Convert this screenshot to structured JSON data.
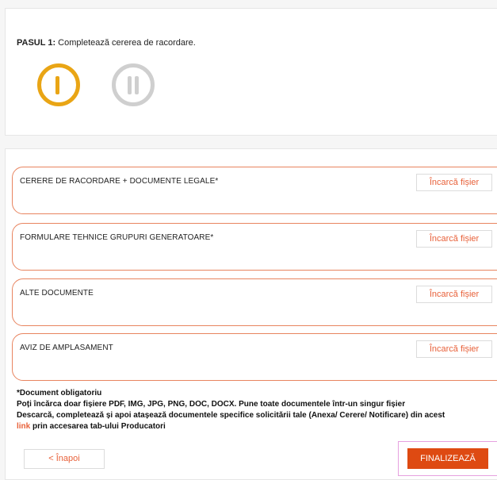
{
  "step": {
    "label": "PASUL 1:",
    "description": "Completează cererea de racordare."
  },
  "steps_colors": {
    "active": "#e9a515",
    "inactive": "#cfcfcf"
  },
  "uploads": [
    {
      "label": "CERERE DE RACORDARE + DOCUMENTE LEGALE*",
      "button": "Încarcă fișier"
    },
    {
      "label": "FORMULARE TEHNICE GRUPURI GENERATOARE*",
      "button": "Încarcă fișier"
    },
    {
      "label": "ALTE DOCUMENTE",
      "button": "Încarcă fișier"
    },
    {
      "label": "AVIZ DE AMPLASAMENT",
      "button": "Încarcă fișier"
    }
  ],
  "notes": {
    "required": "*Document obligatoriu",
    "formats": "Poți încărca doar fișiere PDF, IMG, JPG, PNG, DOC, DOCX. Pune toate documentele într-un singur fișier",
    "download": "Descarcă, completează și apoi atașează documentele specifice solicitării tale (Anexa/ Cerere/ Notificare) din acest",
    "link_text": "link",
    "link_suffix": " prin accesarea tab-ului Producatori"
  },
  "buttons": {
    "back": "< Înapoi",
    "finalize": "FINALIZEAZĂ"
  },
  "colors": {
    "accent": "#e8613a",
    "primary": "#de4a12",
    "border": "#e8845f"
  }
}
